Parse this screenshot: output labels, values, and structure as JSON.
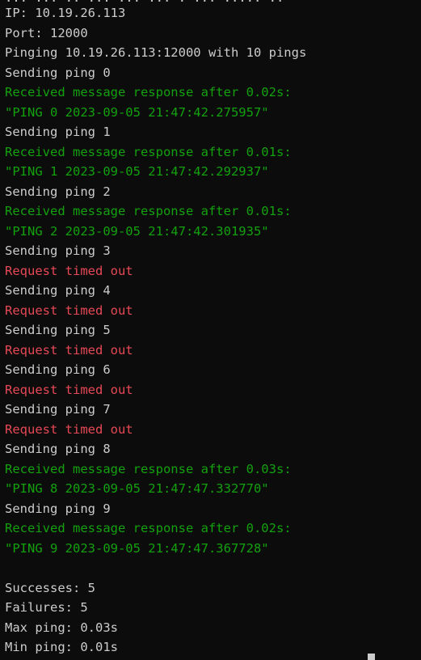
{
  "terminal": {
    "top_partial": "... ... .. ... ... ... . ... ..... ..",
    "lines": [
      {
        "text": "IP: 10.19.26.113",
        "color": "white"
      },
      {
        "text": "Port: 12000",
        "color": "white"
      },
      {
        "text": "Pinging 10.19.26.113:12000 with 10 pings",
        "color": "white"
      },
      {
        "text": "Sending ping 0",
        "color": "white"
      },
      {
        "text": "Received message response after 0.02s:",
        "color": "green"
      },
      {
        "text": "\"PING 0 2023-09-05 21:47:42.275957\"",
        "color": "green"
      },
      {
        "text": "Sending ping 1",
        "color": "white"
      },
      {
        "text": "Received message response after 0.01s:",
        "color": "green"
      },
      {
        "text": "\"PING 1 2023-09-05 21:47:42.292937\"",
        "color": "green"
      },
      {
        "text": "Sending ping 2",
        "color": "white"
      },
      {
        "text": "Received message response after 0.01s:",
        "color": "green"
      },
      {
        "text": "\"PING 2 2023-09-05 21:47:42.301935\"",
        "color": "green"
      },
      {
        "text": "Sending ping 3",
        "color": "white"
      },
      {
        "text": "Request timed out",
        "color": "red"
      },
      {
        "text": "Sending ping 4",
        "color": "white"
      },
      {
        "text": "Request timed out",
        "color": "red"
      },
      {
        "text": "Sending ping 5",
        "color": "white"
      },
      {
        "text": "Request timed out",
        "color": "red"
      },
      {
        "text": "Sending ping 6",
        "color": "white"
      },
      {
        "text": "Request timed out",
        "color": "red"
      },
      {
        "text": "Sending ping 7",
        "color": "white"
      },
      {
        "text": "Request timed out",
        "color": "red"
      },
      {
        "text": "Sending ping 8",
        "color": "white"
      },
      {
        "text": "Received message response after 0.03s:",
        "color": "green"
      },
      {
        "text": "\"PING 8 2023-09-05 21:47:47.332770\"",
        "color": "green"
      },
      {
        "text": "Sending ping 9",
        "color": "white"
      },
      {
        "text": "Received message response after 0.02s:",
        "color": "green"
      },
      {
        "text": "\"PING 9 2023-09-05 21:47:47.367728\"",
        "color": "green"
      },
      {
        "text": "",
        "color": "white"
      },
      {
        "text": "Successes: 5",
        "color": "white"
      },
      {
        "text": "Failures: 5",
        "color": "white"
      },
      {
        "text": "Max ping: 0.03s",
        "color": "white"
      },
      {
        "text": "Min ping: 0.01s",
        "color": "white"
      }
    ]
  },
  "colors": {
    "background": "#0c0c0c",
    "text": "#cccccc",
    "success": "#13a10e",
    "error": "#e74856"
  }
}
